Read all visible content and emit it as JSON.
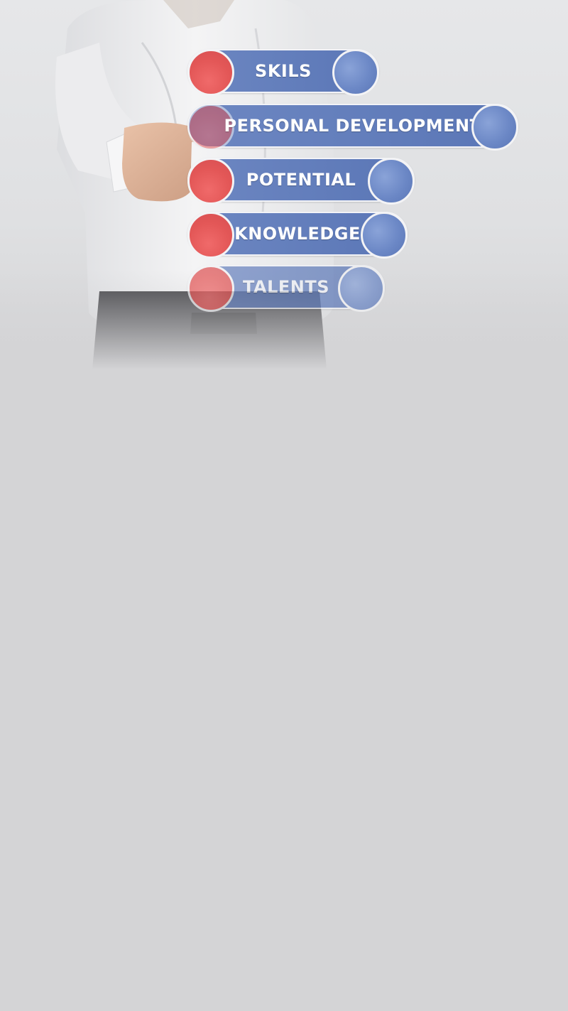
{
  "colors": {
    "background": "#d4d4d6",
    "pill_blue": "#5a76b6",
    "dot_red": "#e35757",
    "label_text": "#ffffff"
  },
  "pills": [
    {
      "label": "SKILS"
    },
    {
      "label": "PERSONAL DEVELOPMENT"
    },
    {
      "label": "POTENTIAL"
    },
    {
      "label": "KNOWLEDGE"
    },
    {
      "label": "TALENTS"
    }
  ]
}
